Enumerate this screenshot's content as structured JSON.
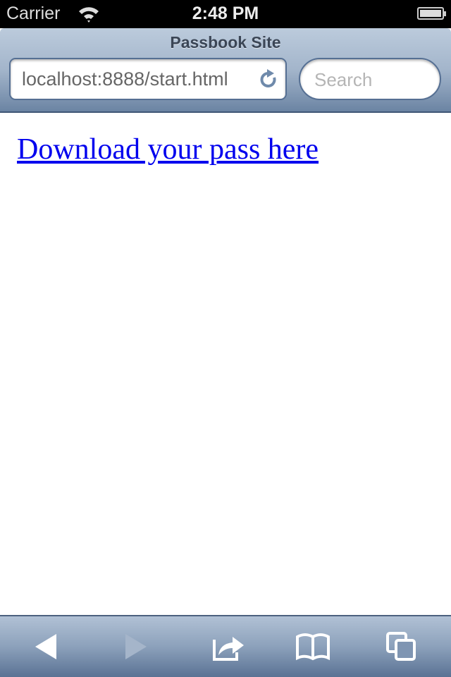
{
  "status_bar": {
    "carrier": "Carrier",
    "time": "2:48 PM",
    "battery_level": 1.0
  },
  "navbar": {
    "title": "Passbook Site",
    "url": "localhost:8888/start.html",
    "search_placeholder": "Search"
  },
  "content": {
    "link_text": "Download your pass here",
    "link_color": "#0000ee"
  },
  "toolbar": {
    "icons": [
      "back-icon",
      "forward-icon",
      "share-icon",
      "bookmarks-icon",
      "tabs-icon"
    ],
    "forward_enabled": false
  }
}
